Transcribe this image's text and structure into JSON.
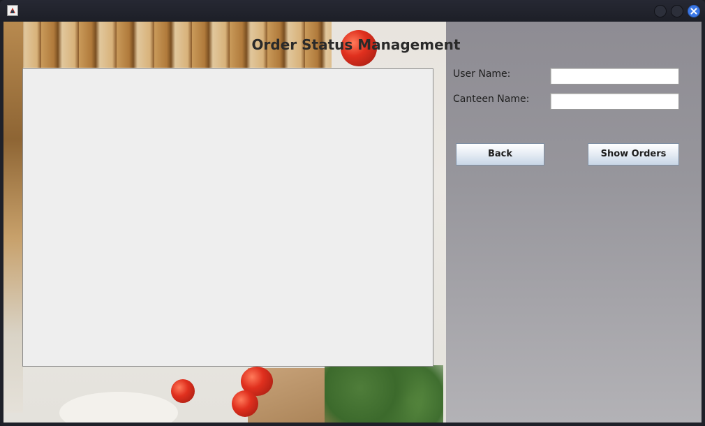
{
  "window": {
    "title_icon": "java-app-icon",
    "controls": [
      "minimize-icon",
      "maximize-icon",
      "close-icon"
    ],
    "close_color": "#3b78e7"
  },
  "form": {
    "title": "Order Status Management",
    "user_name_label": "User Name:",
    "user_name_value": "",
    "canteen_name_label": "Canteen Name:",
    "canteen_name_value": "",
    "back_label": "Back",
    "show_orders_label": "Show Orders",
    "orders_list": []
  }
}
